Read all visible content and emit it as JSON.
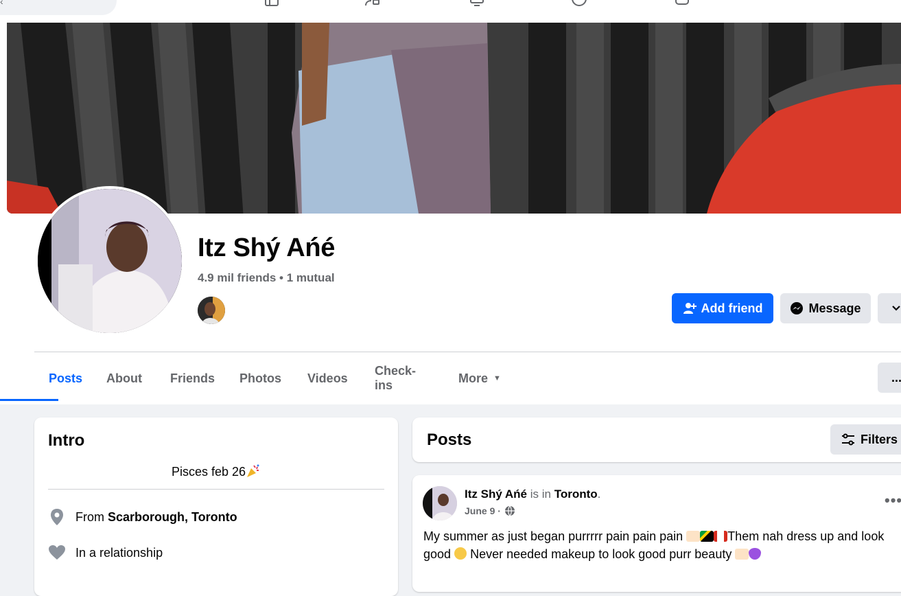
{
  "nav": {
    "icons": [
      "marketplace-icon",
      "groups-icon",
      "watch-icon",
      "profile-icon",
      "gaming-icon"
    ]
  },
  "profile": {
    "name": "Itz Shý Ańé",
    "friends_line": "4.9 mil friends • 1 mutual"
  },
  "actions": {
    "add_friend": "Add friend",
    "message": "Message"
  },
  "tabs": [
    {
      "label": "Posts",
      "active": true
    },
    {
      "label": "About"
    },
    {
      "label": "Friends"
    },
    {
      "label": "Photos"
    },
    {
      "label": "Videos"
    },
    {
      "label": "Check-ins"
    },
    {
      "label": "More"
    }
  ],
  "tabs_menu": "...",
  "intro": {
    "title": "Intro",
    "bio": "Pisces feb 26",
    "from_prefix": "From",
    "from_place": "Scarborough, Toronto",
    "relationship": "In a relationship"
  },
  "posts_section": {
    "title": "Posts",
    "filters": "Filters"
  },
  "post": {
    "author": "Itz Shý Ańé",
    "is_in": "is in",
    "location": "Toronto",
    "date": "June 9",
    "options": "•••",
    "text_line1": "My summer as just began purrrrr pain pain pain",
    "text_line1b": "Them nah dress up and look",
    "text_line2a": "good",
    "text_line2b": "Never needed makeup to look good purr beauty"
  },
  "colors": {
    "accent": "#0866ff",
    "secondary_text": "#65676b",
    "page_bg": "#f0f2f5",
    "button_gray": "#e4e6eb"
  }
}
